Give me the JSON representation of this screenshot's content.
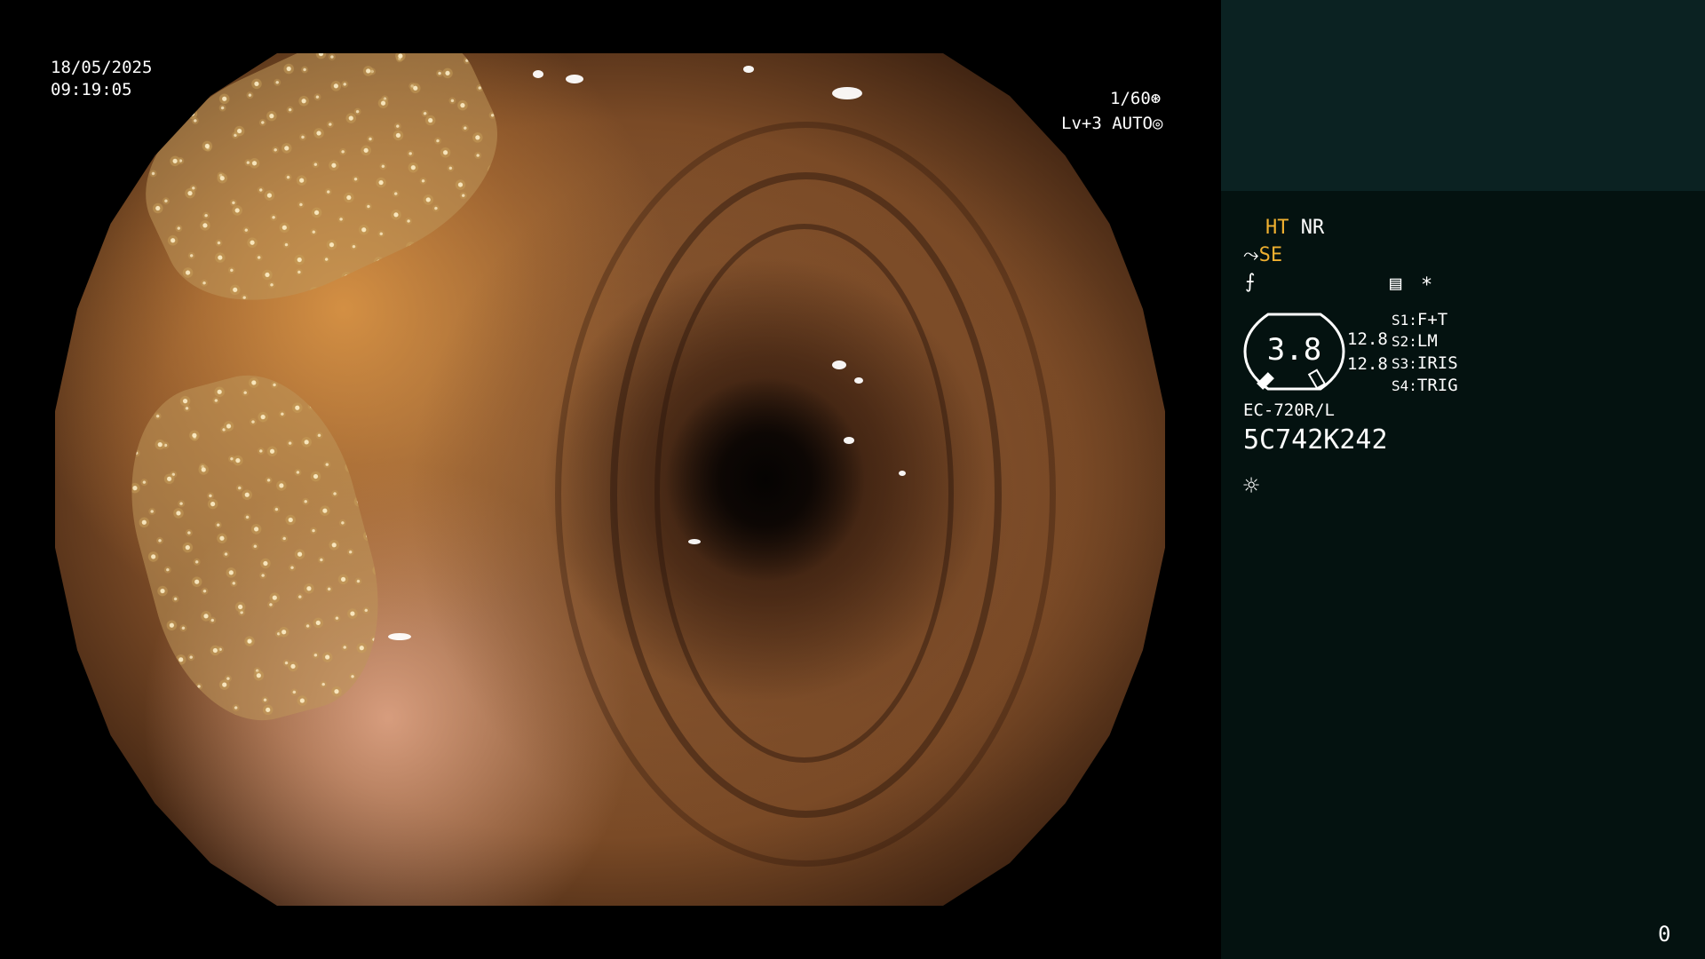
{
  "overlay": {
    "date": "18/05/2025",
    "time": "09:19:05",
    "shutter": "1/60",
    "shutter_icon": "⊛",
    "level": "Lv+3 AUTO",
    "level_icon": "◎"
  },
  "panel": {
    "ht": "HT",
    "nr": "NR",
    "se_icon": "⤳",
    "se": "SE",
    "f_icon": "⨍",
    "mem_icon": "▤",
    "asterisk": "*",
    "gauge_value": "3.8",
    "value_top": "12.8",
    "value_bottom": "12.8",
    "switches": [
      {
        "key": "S1:",
        "val": "F+T"
      },
      {
        "key": "S2:",
        "val": "LM"
      },
      {
        "key": "S3:",
        "val": "IRIS"
      },
      {
        "key": "S4:",
        "val": "TRIG"
      }
    ],
    "scope_model": "EC-720R/L",
    "serial": "5C742K242",
    "light_icon": "☼",
    "counter": "0"
  },
  "colors": {
    "accent": "#f0b030",
    "panel_bg": "#041210",
    "panel_top": "#0b2222"
  }
}
